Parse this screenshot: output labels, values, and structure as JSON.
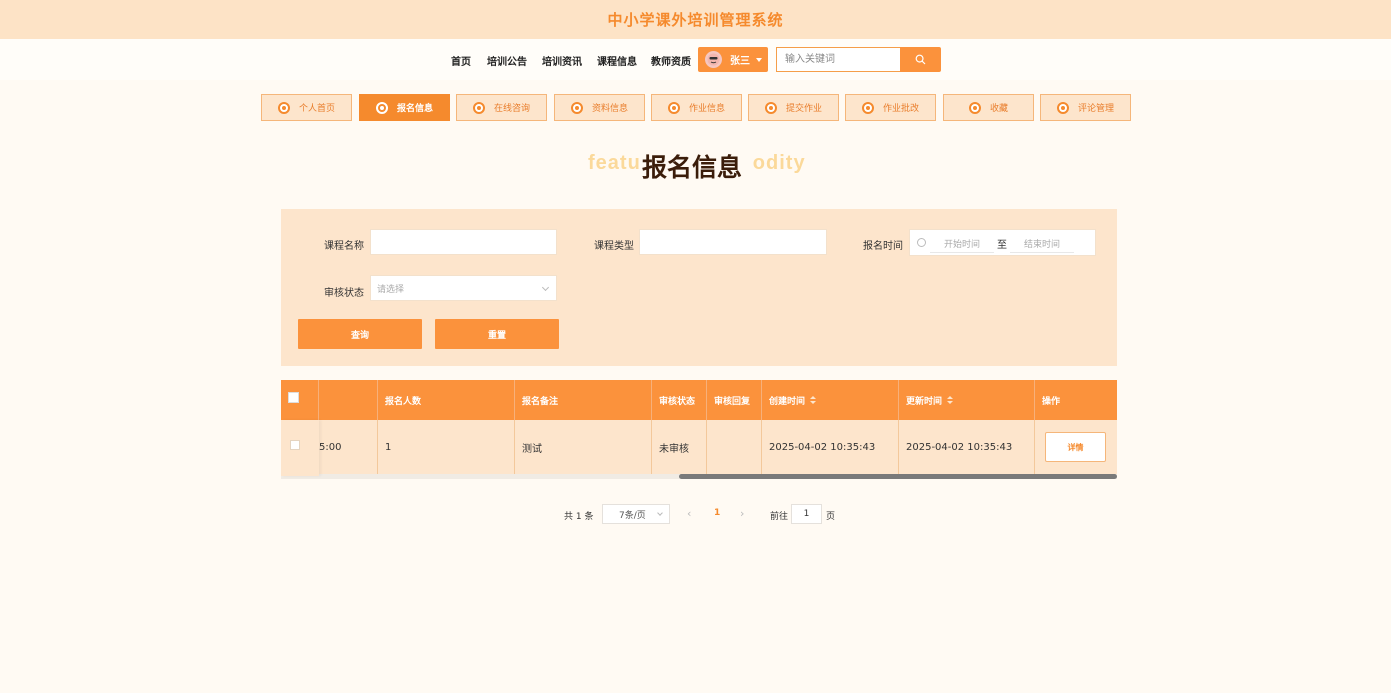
{
  "app": {
    "title": "中小学课外培训管理系统"
  },
  "nav": {
    "items": [
      "首页",
      "培训公告",
      "培训资讯",
      "课程信息",
      "教师资质"
    ],
    "user": {
      "name": "张三",
      "avatar_icon": "avatar-face-icon"
    },
    "search": {
      "placeholder": "输入关键词",
      "icon": "search-icon"
    }
  },
  "tabs": [
    {
      "label": "个人首页",
      "active": false
    },
    {
      "label": "报名信息",
      "active": true
    },
    {
      "label": "在线咨询",
      "active": false
    },
    {
      "label": "资料信息",
      "active": false
    },
    {
      "label": "作业信息",
      "active": false
    },
    {
      "label": "提交作业",
      "active": false
    },
    {
      "label": "作业批改",
      "active": false
    },
    {
      "label": "收藏",
      "active": false
    },
    {
      "label": "评论管理",
      "active": false
    }
  ],
  "page": {
    "heading": "报名信息",
    "heading_bg_left": "featu",
    "heading_bg_right": "odity"
  },
  "filters": {
    "course_name_label": "课程名称",
    "course_type_label": "课程类型",
    "signup_time_label": "报名时间",
    "start_placeholder": "开始时间",
    "range_sep": "至",
    "end_placeholder": "结束时间",
    "review_status_label": "审核状态",
    "review_status_placeholder": "请选择",
    "query_button": "查询",
    "reset_button": "重置"
  },
  "table": {
    "columns": [
      "报名人数",
      "报名备注",
      "审核状态",
      "审核回复",
      "创建时间",
      "更新时间",
      "操作"
    ],
    "rows": [
      {
        "partial_prev": "5:00",
        "count": "1",
        "remark": "测试",
        "status": "未审核",
        "reply": "",
        "created": "2025-04-02 10:35:43",
        "updated": "2025-04-02 10:35:43",
        "action": "详情"
      }
    ]
  },
  "pagination": {
    "total": "共 1 条",
    "page_size": "7条/页",
    "current_page": "1",
    "goto_label": "前往",
    "goto_value": "1",
    "page_word": "页"
  },
  "colors": {
    "accent": "#fb923c",
    "panel": "#fde5cc",
    "header_bg": "#fde3c6",
    "title": "#f58a2d"
  }
}
